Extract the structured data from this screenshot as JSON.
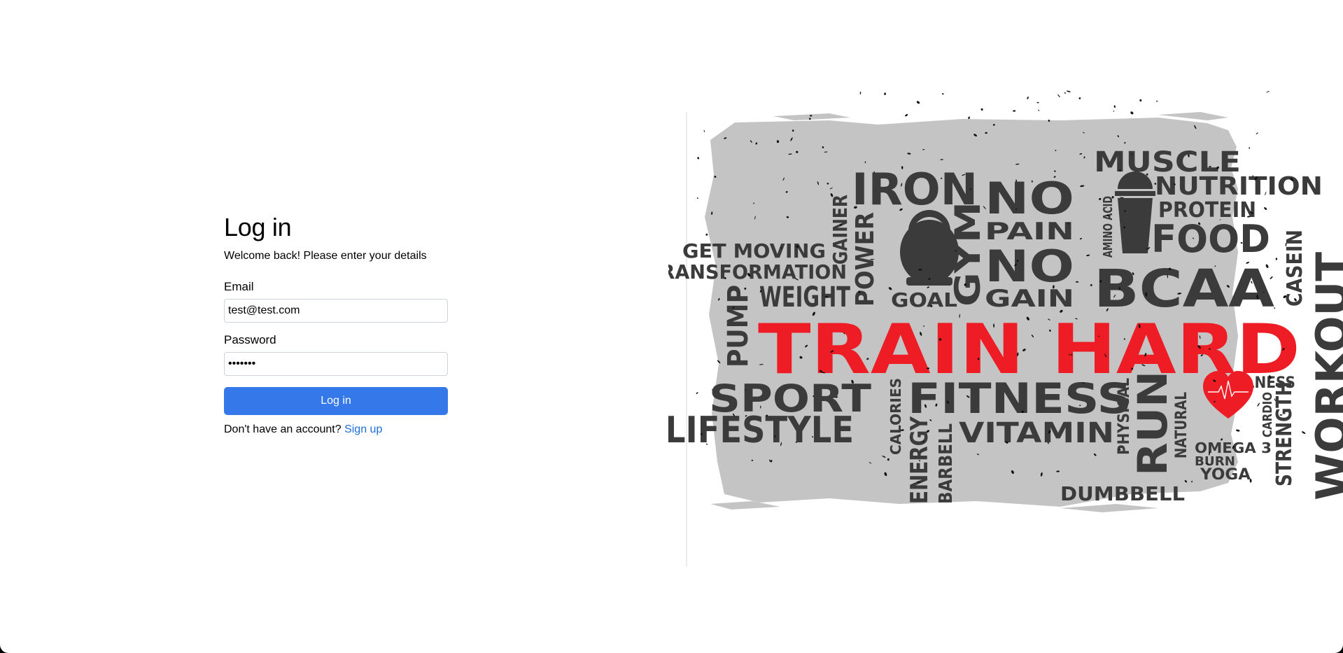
{
  "login": {
    "title": "Log in",
    "subtitle": "Welcome back! Please enter your details",
    "email_label": "Email",
    "email_value": "test@test.com",
    "password_label": "Password",
    "password_value": "•••••••",
    "submit_label": "Log in",
    "no_account_text": "Don't have an account?",
    "signup_label": "Sign up"
  },
  "hero_image": {
    "words": {
      "iron": "IRON",
      "no_1": "NO",
      "pain": "PAIN",
      "no_2": "NO",
      "gain": "GAIN",
      "muscle": "MUSCLE",
      "nutrition": "NUTRITION",
      "protein": "PROTEIN",
      "food": "FOOD",
      "bcaa": "BCAA",
      "casein": "CASEIN",
      "workout": "WORKOUT",
      "get_moving": "GET MOVING",
      "transformation": "TRANSFORMATION",
      "weight": "WEIGHT",
      "goal": "GOAL",
      "gainer": "GAINER",
      "power": "POWER",
      "gym": "GYM",
      "amino_acid": "AMINO ACID",
      "pump": "PUMP",
      "train_hard": "TRAIN HARD",
      "sport": "SPORT",
      "fitness": "FITNESS",
      "lifestyle": "LIFESTYLE",
      "calories": "CALORIES",
      "energy": "ENERGY",
      "barbell": "BARBELL",
      "vitamin": "VITAMIN",
      "physical": "PHYSICAL",
      "run": "RUN",
      "natural": "NATURAL",
      "wellness": "WELLNESS",
      "cardio": "CARDIO",
      "strength": "STRENGTH",
      "omega_3": "OMEGA 3",
      "burn": "BURN",
      "yoga": "YOGA",
      "dumbbell": "DUMBBELL"
    },
    "colors": {
      "ink": "#3b3b3b",
      "accent": "#ee1c24",
      "blob": "#c4c4c4",
      "speckle": "#111111"
    }
  }
}
